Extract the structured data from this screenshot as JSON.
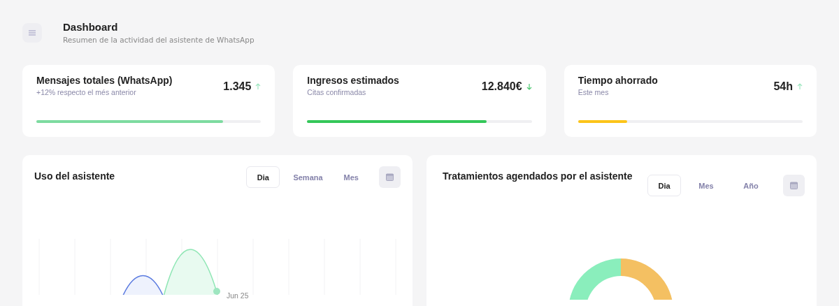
{
  "header": {
    "title": "Dashboard",
    "subtitle": "Resumen de la actividad del asistente de WhatsApp"
  },
  "stats": [
    {
      "title": "Mensajes totales (WhatsApp)",
      "subtitle": "+12% respecto el més anterior",
      "value": "1.345",
      "rising": true,
      "level": 0.83,
      "color": "#7ddba0"
    },
    {
      "title": "Ingresos estimados",
      "subtitle": "Citas confirmadas",
      "value": "12.840€",
      "rising": false,
      "level": 0.8,
      "color": "#34c759"
    },
    {
      "title": "Tiempo ahorrado",
      "subtitle": "Este mes",
      "value": "54h",
      "rising": true,
      "level": 0.22,
      "color": "#fcc419"
    }
  ],
  "usage": {
    "title": "Uso del asistente",
    "tabs": [
      {
        "label": "Dia",
        "selected": true
      },
      {
        "label": "Semana",
        "selected": false
      },
      {
        "label": "Mes",
        "selected": false
      }
    ],
    "tooltip": "Jun 25"
  },
  "treatments": {
    "title": "Tratamientos agendados por el asistente",
    "tabs": [
      {
        "label": "Dia",
        "selected": true
      },
      {
        "label": "Mes",
        "selected": false
      },
      {
        "label": "Año",
        "selected": false
      }
    ]
  }
}
